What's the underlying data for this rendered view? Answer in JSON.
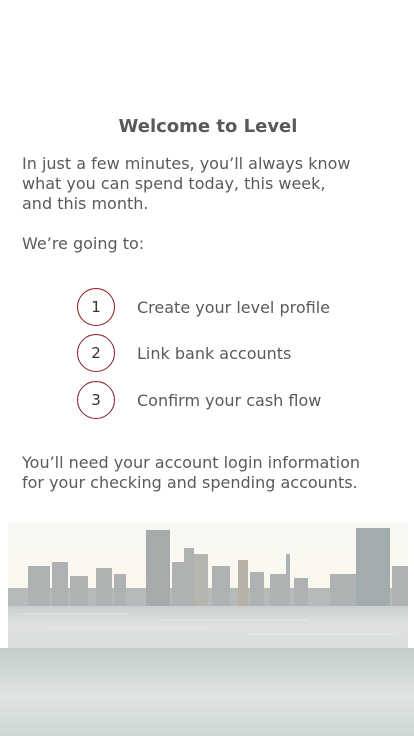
{
  "welcome": {
    "title": "Welcome to Level",
    "intro": "In just a few minutes, you’ll always know\nwhat you can spend today, this week,\nand this month.",
    "going_to": "We’re going to:"
  },
  "steps": [
    {
      "number": "1",
      "label": "Create your level profile"
    },
    {
      "number": "2",
      "label": "Link bank accounts"
    },
    {
      "number": "3",
      "label": "Confirm your cash flow"
    }
  ],
  "note": "You’ll need your account login information\nfor your checking and spending accounts.",
  "colors": {
    "step_circle_border": "#8b1a1a",
    "text": "#5a5a5a",
    "footer_band": "#d6dddc"
  }
}
